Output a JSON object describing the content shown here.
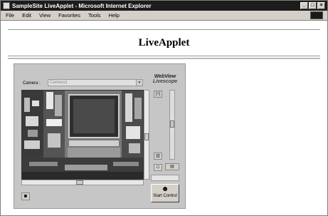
{
  "window": {
    "title": "SampleSite LiveApplet - Microsoft Internet Explorer",
    "min_label": "_",
    "max_label": "□",
    "close_label": "×"
  },
  "menu": {
    "items": [
      "File",
      "Edit",
      "View",
      "Favorites",
      "Tools",
      "Help"
    ]
  },
  "page": {
    "title": "LiveApplet"
  },
  "applet": {
    "camera_label": "Camera :",
    "camera_value": "Camera1",
    "brand_line1": "WebView",
    "brand_line2": "Livescope",
    "start_control_label": "Start Control"
  }
}
